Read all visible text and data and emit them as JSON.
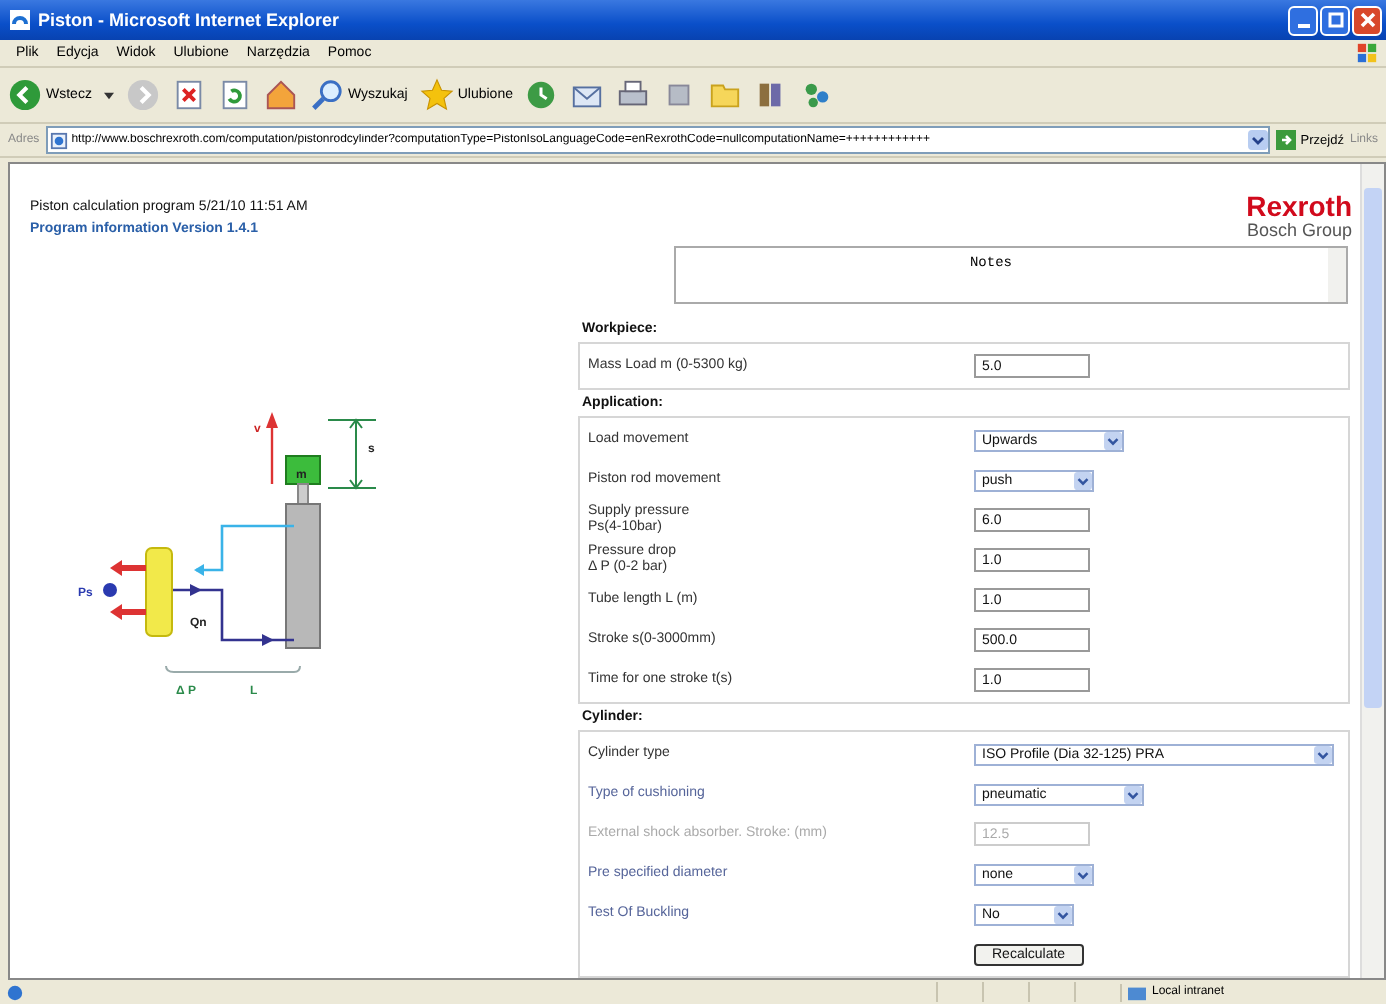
{
  "window": {
    "title": "Piston - Microsoft Internet Explorer"
  },
  "menu": [
    "Plik",
    "Edycja",
    "Widok",
    "Ulubione",
    "Narzędzia",
    "Pomoc"
  ],
  "toolbar": {
    "back": "Wstecz",
    "search": "Wyszukaj",
    "favorites": "Ulubione"
  },
  "address": {
    "label": "Adres",
    "url": "http://www.boschrexroth.com/computation/pistonrodcylinder?computationType=PistonIsoLanguageCode=enRexrothCode=nullcomputationName=++++++++++++",
    "go": "Przejdź",
    "links": "Links"
  },
  "page": {
    "title": "Piston calculation program 5/21/10 11:51 AM",
    "version_link": "Program information Version 1.4.1",
    "logo": {
      "brand": "Rexroth",
      "group": "Bosch Group"
    },
    "notes": "Notes",
    "diagram": {
      "velocity": "v",
      "stroke": "s",
      "mass": "m",
      "supply": "Ps",
      "flow": "Qn",
      "pressure_drop": "Δ P",
      "length": "L"
    },
    "sections": [
      {
        "title": "Workpiece:",
        "rows": [
          {
            "kind": "input",
            "label": "Mass Load m (0-5300 kg)",
            "value": "5.0",
            "dependent": false,
            "disabled": false
          }
        ]
      },
      {
        "title": "Application:",
        "rows": [
          {
            "kind": "select",
            "label": "Load movement",
            "value": "Upwards",
            "dependent": false,
            "disabled": false
          },
          {
            "kind": "select",
            "label": "Piston rod movement",
            "value": "push",
            "dependent": false,
            "disabled": false
          },
          {
            "kind": "input",
            "label": "Supply pressure\nPs(4-10bar)",
            "value": "6.0",
            "dependent": false,
            "disabled": false
          },
          {
            "kind": "input",
            "label": "Pressure drop\nΔ P (0-2 bar)",
            "value": "1.0",
            "dependent": false,
            "disabled": false
          },
          {
            "kind": "input",
            "label": "Tube length L (m)",
            "value": "1.0",
            "dependent": false,
            "disabled": false
          },
          {
            "kind": "input",
            "label": "Stroke s(0-3000mm)",
            "value": "500.0",
            "dependent": false,
            "disabled": false
          },
          {
            "kind": "input",
            "label": "Time for one stroke t(s)",
            "value": "1.0",
            "dependent": false,
            "disabled": false
          }
        ]
      },
      {
        "title": "Cylinder:",
        "rows": [
          {
            "kind": "select",
            "label": "Cylinder type",
            "value": "ISO Profile (Dia 32-125) PRA",
            "dependent": false,
            "disabled": false
          },
          {
            "kind": "select",
            "label": "Type of cushioning",
            "value": "pneumatic",
            "dependent": true,
            "disabled": false
          },
          {
            "kind": "input",
            "label": "External shock absorber. Stroke: (mm)",
            "value": "12.5",
            "dependent": false,
            "disabled": true
          },
          {
            "kind": "select",
            "label": "Pre specified diameter",
            "value": "none",
            "dependent": true,
            "disabled": false
          },
          {
            "kind": "select",
            "label": "Test Of Buckling",
            "value": "No",
            "dependent": true,
            "disabled": false
          },
          {
            "kind": "button",
            "value": "Recalculate"
          }
        ]
      }
    ]
  },
  "status_bar": {
    "zone": "Local intranet"
  }
}
